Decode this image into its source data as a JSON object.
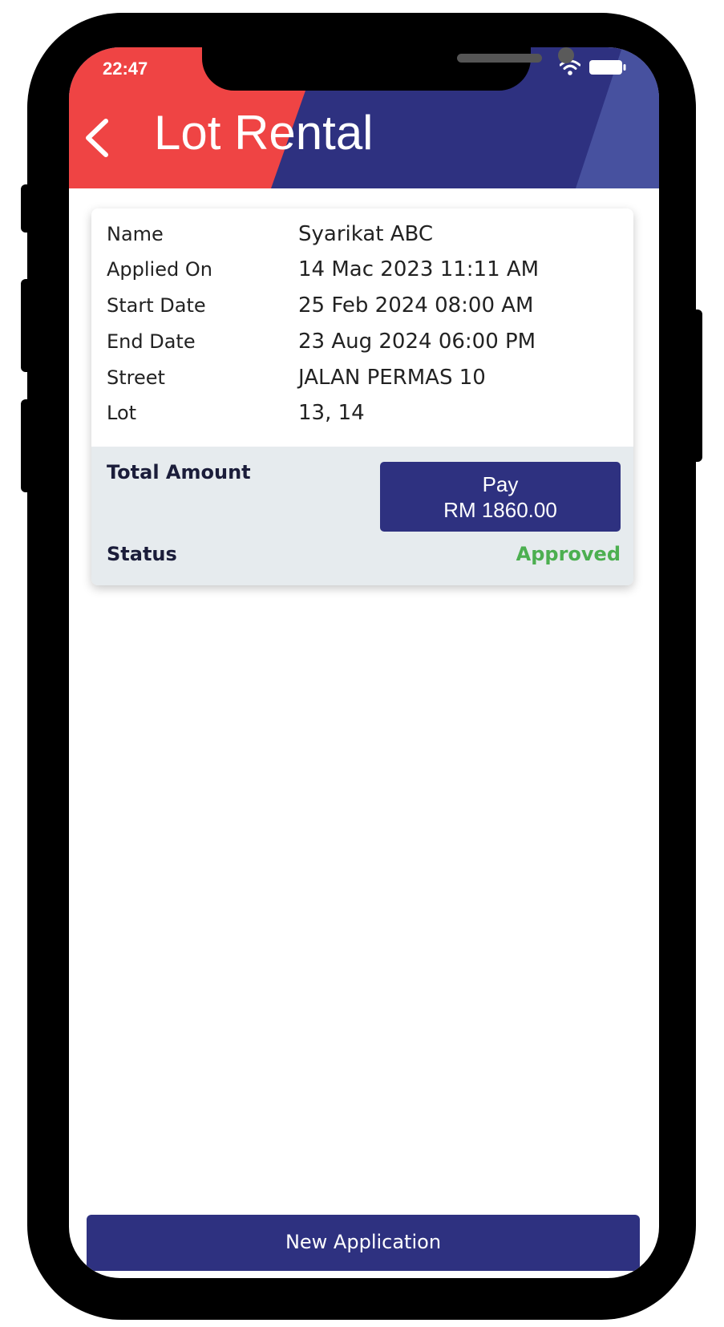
{
  "status_bar": {
    "time": "22:47"
  },
  "header": {
    "title": "Lot Rental"
  },
  "details": [
    {
      "label": "Name",
      "value": "Syarikat ABC"
    },
    {
      "label": "Applied On",
      "value": "14 Mac 2023 11:11 AM"
    },
    {
      "label": "Start Date",
      "value": "25 Feb 2024 08:00 AM"
    },
    {
      "label": "End Date",
      "value": "23 Aug 2024 06:00 PM"
    },
    {
      "label": "Street",
      "value": "JALAN PERMAS 10"
    },
    {
      "label": "Lot",
      "value": "13, 14"
    }
  ],
  "summary": {
    "total_label": "Total Amount",
    "pay_label": "Pay",
    "pay_amount": "RM 1860.00",
    "status_label": "Status",
    "status_value": "Approved"
  },
  "actions": {
    "new_application": "New Application"
  },
  "colors": {
    "primary": "#2e3180",
    "header_red": "#ef4444",
    "status_approved": "#4caf50"
  },
  "icons": [
    "back-icon",
    "wifi-icon",
    "battery-icon"
  ]
}
